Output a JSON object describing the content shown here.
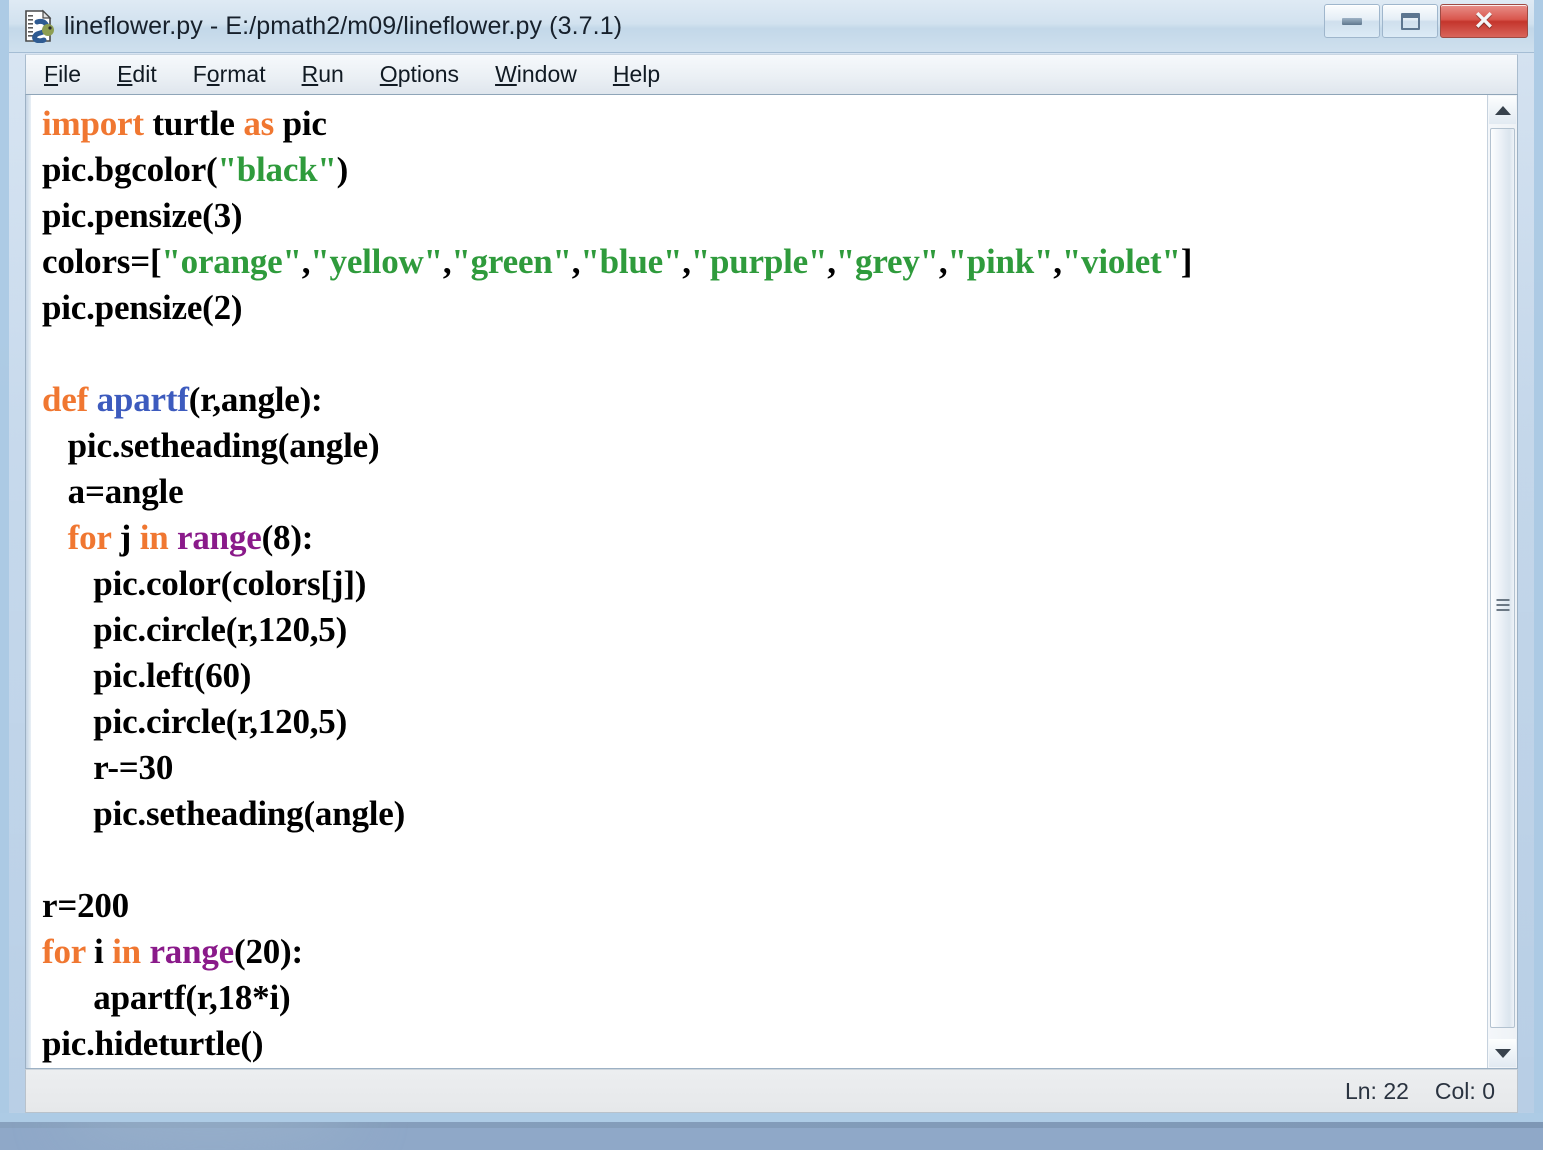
{
  "window": {
    "title": "lineflower.py - E:/pmath2/m09/lineflower.py (3.7.1)",
    "icon": "python-file-icon",
    "controls": {
      "minimize": "minimize-button",
      "maximize": "restore-button",
      "close": "close-button",
      "close_glyph": "✕"
    },
    "colors": {
      "title_bar_top": "#dfeaf4",
      "frame_border": "#abc9e4",
      "close_button": "#c4352c"
    }
  },
  "menubar": {
    "items": [
      {
        "label": "File",
        "accel": "F"
      },
      {
        "label": "Edit",
        "accel": "E"
      },
      {
        "label": "Format",
        "accel": "o"
      },
      {
        "label": "Run",
        "accel": "R"
      },
      {
        "label": "Options",
        "accel": "O"
      },
      {
        "label": "Window",
        "accel": "W"
      },
      {
        "label": "Help",
        "accel": "H"
      }
    ]
  },
  "editor": {
    "syntax_colors": {
      "keyword": "#f07731",
      "string": "#2f9b3c",
      "builtin": "#8a1a8a",
      "definition": "#3d5bbe",
      "plain": "#000000",
      "background": "#ffffff"
    },
    "lines": [
      [
        {
          "t": "import",
          "c": "kw"
        },
        {
          "t": " turtle ",
          "c": "plain"
        },
        {
          "t": "as",
          "c": "kw"
        },
        {
          "t": " pic",
          "c": "plain"
        }
      ],
      [
        {
          "t": "pic.bgcolor(",
          "c": "plain"
        },
        {
          "t": "\"black\"",
          "c": "str"
        },
        {
          "t": ")",
          "c": "plain"
        }
      ],
      [
        {
          "t": "pic.pensize(3)",
          "c": "plain"
        }
      ],
      [
        {
          "t": "colors=[",
          "c": "plain"
        },
        {
          "t": "\"orange\"",
          "c": "str"
        },
        {
          "t": ",",
          "c": "plain"
        },
        {
          "t": "\"yellow\"",
          "c": "str"
        },
        {
          "t": ",",
          "c": "plain"
        },
        {
          "t": "\"green\"",
          "c": "str"
        },
        {
          "t": ",",
          "c": "plain"
        },
        {
          "t": "\"blue\"",
          "c": "str"
        },
        {
          "t": ",",
          "c": "plain"
        },
        {
          "t": "\"purple\"",
          "c": "str"
        },
        {
          "t": ",",
          "c": "plain"
        },
        {
          "t": "\"grey\"",
          "c": "str"
        },
        {
          "t": ",",
          "c": "plain"
        },
        {
          "t": "\"pink\"",
          "c": "str"
        },
        {
          "t": ",",
          "c": "plain"
        },
        {
          "t": "\"violet\"",
          "c": "str"
        },
        {
          "t": "]",
          "c": "plain"
        }
      ],
      [
        {
          "t": "pic.pensize(2)",
          "c": "plain"
        }
      ],
      [
        {
          "t": "",
          "c": "plain"
        }
      ],
      [
        {
          "t": "def",
          "c": "kw"
        },
        {
          "t": " ",
          "c": "plain"
        },
        {
          "t": "apartf",
          "c": "def"
        },
        {
          "t": "(r,angle):",
          "c": "plain"
        }
      ],
      [
        {
          "t": "   pic.setheading(angle)",
          "c": "plain"
        }
      ],
      [
        {
          "t": "   a=angle",
          "c": "plain"
        }
      ],
      [
        {
          "t": "   ",
          "c": "plain"
        },
        {
          "t": "for",
          "c": "kw"
        },
        {
          "t": " j ",
          "c": "plain"
        },
        {
          "t": "in",
          "c": "kw"
        },
        {
          "t": " ",
          "c": "plain"
        },
        {
          "t": "range",
          "c": "bi"
        },
        {
          "t": "(8):",
          "c": "plain"
        }
      ],
      [
        {
          "t": "      pic.color(colors[j])",
          "c": "plain"
        }
      ],
      [
        {
          "t": "      pic.circle(r,120,5)",
          "c": "plain"
        }
      ],
      [
        {
          "t": "      pic.left(60)",
          "c": "plain"
        }
      ],
      [
        {
          "t": "      pic.circle(r,120,5)",
          "c": "plain"
        }
      ],
      [
        {
          "t": "      r-=30",
          "c": "plain"
        }
      ],
      [
        {
          "t": "      pic.setheading(angle)",
          "c": "plain"
        }
      ],
      [
        {
          "t": "",
          "c": "plain"
        }
      ],
      [
        {
          "t": "r=200",
          "c": "plain"
        }
      ],
      [
        {
          "t": "for",
          "c": "kw"
        },
        {
          "t": " i ",
          "c": "plain"
        },
        {
          "t": "in",
          "c": "kw"
        },
        {
          "t": " ",
          "c": "plain"
        },
        {
          "t": "range",
          "c": "bi"
        },
        {
          "t": "(20):",
          "c": "plain"
        }
      ],
      [
        {
          "t": "      apartf(r,18*i)",
          "c": "plain"
        }
      ],
      [
        {
          "t": "pic.hideturtle()",
          "c": "plain"
        }
      ]
    ]
  },
  "scrollbar": {
    "up_arrow": "scroll-up-arrow-icon",
    "down_arrow": "scroll-down-arrow-icon",
    "grip": "scrollbar-grip-icon"
  },
  "statusbar": {
    "line_label": "Ln: 22",
    "col_label": "Col: 0"
  }
}
